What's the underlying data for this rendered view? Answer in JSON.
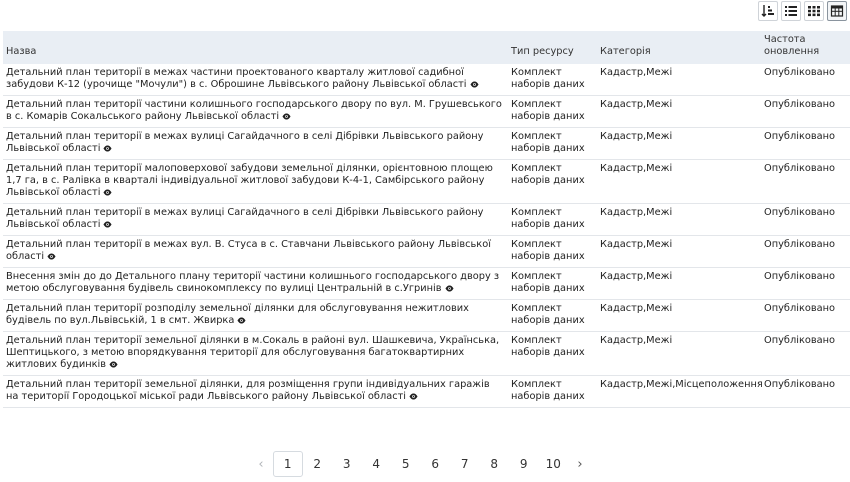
{
  "view_toggles": [
    {
      "name": "sort-view-icon"
    },
    {
      "name": "list-view-icon"
    },
    {
      "name": "grid-view-icon"
    },
    {
      "name": "table-view-icon",
      "active": true
    }
  ],
  "table": {
    "headers": {
      "name": "Назва",
      "type": "Тип ресурсу",
      "category": "Категорія",
      "frequency": "Частота оновлення"
    },
    "rows": [
      {
        "name": "Детальний план території в межах частини проектованого кварталу житлової садибної забудови К-12 (урочище \"Мочули\") в с. Оброшине Львівського району Львівської області",
        "type": "Комплект наборів даних",
        "category": "Кадастр,Межі",
        "frequency": "Опубліковано"
      },
      {
        "name": "Детальний план території частини колишнього господарського двору по вул. М. Грушевського в с. Комарів Сокальського району Львівської області",
        "type": "Комплект наборів даних",
        "category": "Кадастр,Межі",
        "frequency": "Опубліковано"
      },
      {
        "name": "Детальний план території в межах вулиці Сагайдачного в селі Дібрівки Львівського району Львівської області",
        "type": "Комплект наборів даних",
        "category": "Кадастр,Межі",
        "frequency": "Опубліковано"
      },
      {
        "name": "Детальний план території малоповерхової забудови земельної ділянки, орієнтовною площею 1,7 га, в с. Ралівка в кварталі індивідуальної житлової забудови К-4-1, Самбірського району Львівської області",
        "type": "Комплект наборів даних",
        "category": "Кадастр,Межі",
        "frequency": "Опубліковано"
      },
      {
        "name": "Детальний план території в межах вулиці Сагайдачного в селі Дібрівки Львівського району Львівської області",
        "type": "Комплект наборів даних",
        "category": "Кадастр,Межі",
        "frequency": "Опубліковано"
      },
      {
        "name": "Детальний план території в межах вул. В. Стуса в с. Ставчани Львівського району Львівської області",
        "type": "Комплект наборів даних",
        "category": "Кадастр,Межі",
        "frequency": "Опубліковано"
      },
      {
        "name": "Внесення змін до до Детального плану території частини колишнього господарського двору з метою обслуговування будівель свинокомплексу по вулиці Центральній в с.Угринів",
        "type": "Комплект наборів даних",
        "category": "Кадастр,Межі",
        "frequency": "Опубліковано"
      },
      {
        "name": "Детальний план території розподілу земельної ділянки для обслуговування нежитлових будівель по вул.Львівській, 1 в смт. Жвирка",
        "type": "Комплект наборів даних",
        "category": "Кадастр,Межі",
        "frequency": "Опубліковано"
      },
      {
        "name": "Детальний план території земельної ділянки в м.Сокаль в районі вул. Шашкевича, Українська, Шептицького, з метою впорядкування території для обслуговування багатоквартирних житлових будинків",
        "type": "Комплект наборів даних",
        "category": "Кадастр,Межі",
        "frequency": "Опубліковано"
      },
      {
        "name": "Детальний план території земельної ділянки, для розміщення групи індивідуальних гаражів на території Городоцької міської ради Львівського району Львівської області",
        "type": "Комплект наборів даних",
        "category": "Кадастр,Межі,Місцеположення",
        "frequency": "Опубліковано"
      }
    ]
  },
  "pagination": {
    "prev": "‹",
    "pages": [
      "1",
      "2",
      "3",
      "4",
      "5",
      "6",
      "7",
      "8",
      "9",
      "10"
    ],
    "current": "1",
    "next": "›"
  }
}
